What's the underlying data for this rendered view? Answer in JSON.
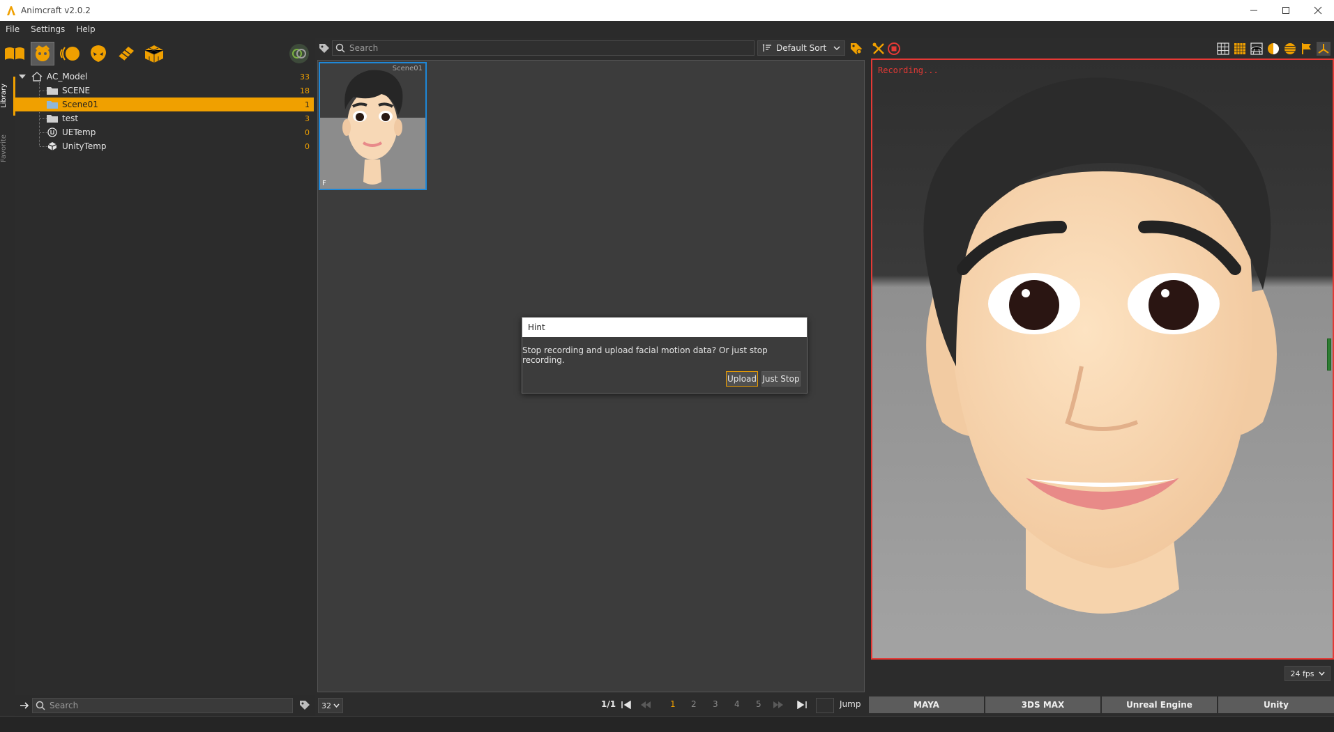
{
  "window": {
    "title": "Animcraft v2.0.2"
  },
  "menu": [
    "File",
    "Settings",
    "Help"
  ],
  "toolbar": {
    "icons": [
      "library-book-icon",
      "face-mask-icon",
      "motion-circle-icon",
      "alien-head-icon",
      "layers-icon",
      "cube-grid-icon"
    ],
    "active_index": 1
  },
  "sidebar_tabs": {
    "library": "Library",
    "favorite": "Favorite"
  },
  "tree": {
    "root": {
      "label": "AC_Model",
      "count": "33"
    },
    "items": [
      {
        "label": "SCENE",
        "count": "18",
        "icon": "folder-icon",
        "selected": false
      },
      {
        "label": "Scene01",
        "count": "1",
        "icon": "folder-icon",
        "selected": true
      },
      {
        "label": "test",
        "count": "3",
        "icon": "folder-icon",
        "selected": false
      },
      {
        "label": "UETemp",
        "count": "0",
        "icon": "unreal-logo-icon",
        "selected": false
      },
      {
        "label": "UnityTemp",
        "count": "0",
        "icon": "unity-logo-icon",
        "selected": false
      }
    ]
  },
  "left_search": {
    "placeholder": "Search"
  },
  "center_search": {
    "placeholder": "Search"
  },
  "sort": {
    "value": "Default Sort"
  },
  "thumbnail": {
    "title": "Scene01",
    "flag": "F"
  },
  "pagination": {
    "per_page": "32",
    "page_info": "1/1",
    "pages": [
      "1",
      "2",
      "3",
      "4",
      "5"
    ],
    "current": "1",
    "jump_label": "Jump"
  },
  "dialog": {
    "title": "Hint",
    "message": "Stop recording and upload facial motion data? Or just stop recording.",
    "primary_button": "Upload",
    "secondary_button": "Just Stop"
  },
  "viewport": {
    "status": "Recording...",
    "fps": "24 fps"
  },
  "export_targets": [
    "MAYA",
    "3DS MAX",
    "Unreal Engine",
    "Unity"
  ],
  "colors": {
    "accent": "#f0a000",
    "recording": "#e53935",
    "selection_border": "#1e88d8"
  }
}
